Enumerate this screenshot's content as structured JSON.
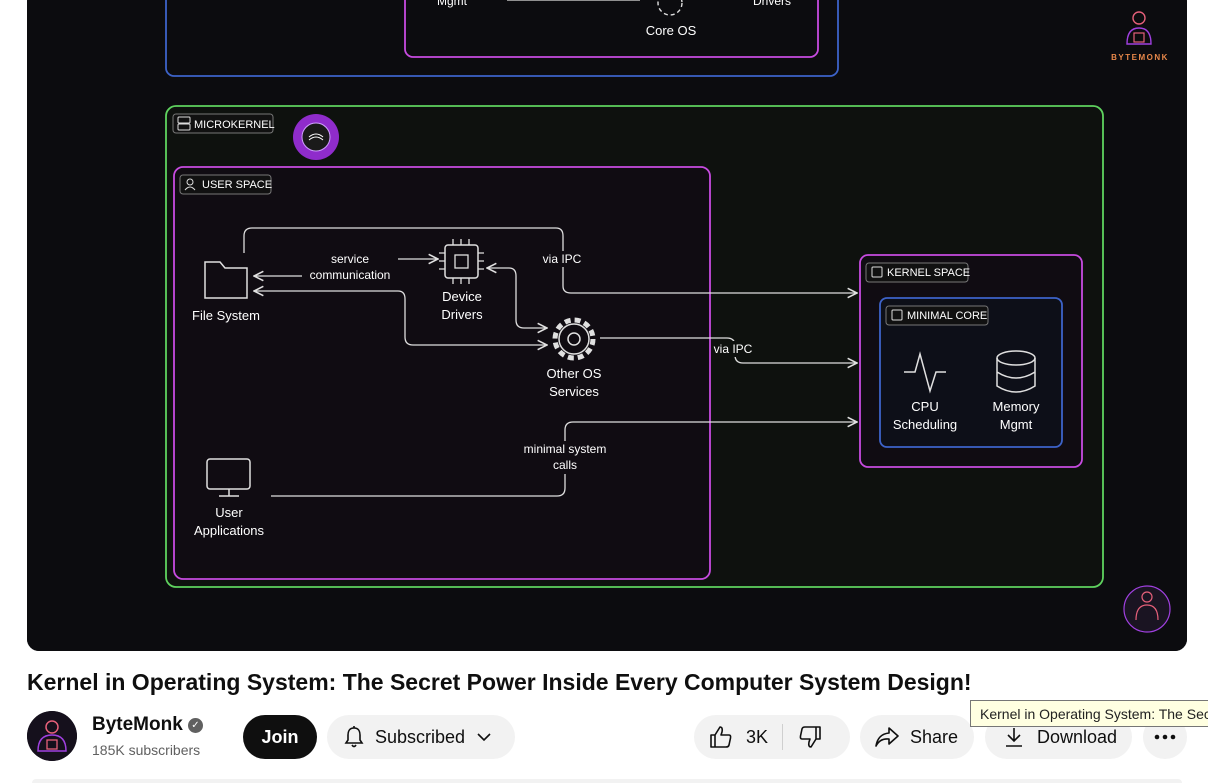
{
  "video": {
    "title": "Kernel in Operating System: The Secret Power Inside Every Computer System Design!",
    "diagram": {
      "top": {
        "mgmt": "Mgmt",
        "core_os": "Core OS",
        "drivers": "Drivers"
      },
      "microkernel_label": "MICROKERNEL",
      "user_space_label": "USER SPACE",
      "file_system": "File System",
      "service_line1": "service",
      "service_line2": "communication",
      "device_line1": "Device",
      "device_line2": "Drivers",
      "via_ipc": "via IPC",
      "other_line1": "Other OS",
      "other_line2": "Services",
      "minimal_line1": "minimal system",
      "minimal_line2": "calls",
      "user_line1": "User",
      "user_line2": "Applications",
      "kernel_space_label": "KERNEL SPACE",
      "minimal_core_label": "MINIMAL CORE",
      "cpu_line1": "CPU",
      "cpu_line2": "Scheduling",
      "mem_line1": "Memory",
      "mem_line2": "Mgmt",
      "watermark": "BYTEMONK"
    }
  },
  "channel": {
    "name": "ByteMonk",
    "subscribers": "185K subscribers",
    "join_label": "Join",
    "subscribed_label": "Subscribed"
  },
  "actions": {
    "likes": "3K",
    "share_label": "Share",
    "download_label": "Download"
  },
  "tooltip": {
    "text": "Kernel in Operating System: The Secret Power Inside Every Computer System Design!"
  },
  "colors": {
    "green": "#5fd35f",
    "magenta": "#c74be0",
    "blue": "#3d63c9",
    "white_line": "#dedede"
  }
}
